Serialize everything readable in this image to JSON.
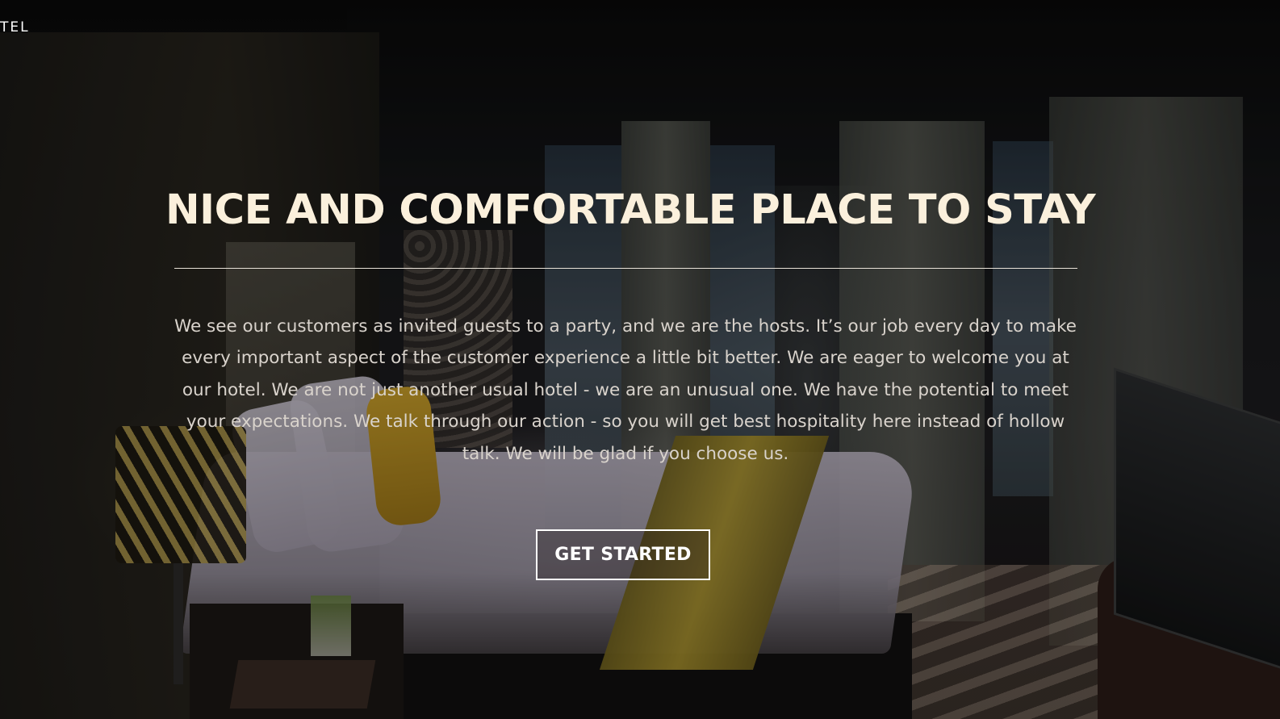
{
  "header": {
    "brand_text": "TEL"
  },
  "hero": {
    "headline": "NICE AND COMFORTABLE PLACE TO STAY",
    "description": "We see our customers as invited guests to a party, and we are the hosts. It’s our job every day to make every important aspect of the customer experience a little bit better. We are eager to welcome you at our hotel. We are not just another usual hotel - we are an unusual one. We have the potential to meet your expectations. We talk through our action - so you will get best hospitality here instead of hollow talk. We will be glad if you choose us.",
    "cta_label": "GET STARTED"
  },
  "colors": {
    "headline": "#fbf0dc",
    "body_text": "#d9d3cc",
    "divider": "#e8e2d8",
    "cta_border": "#ffffff"
  }
}
